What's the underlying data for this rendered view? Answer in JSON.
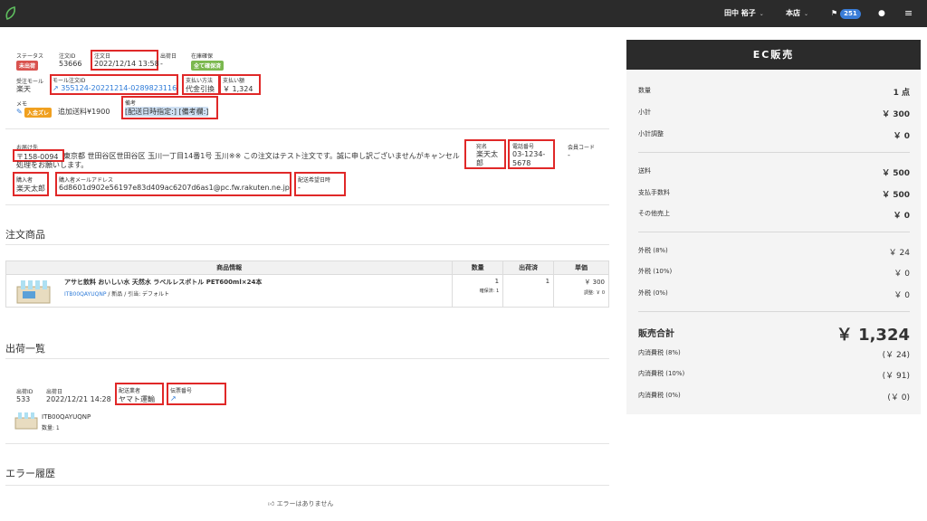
{
  "topbar": {
    "user": "田中 裕子",
    "store": "本店",
    "flag_count": "251",
    "chevron": "⌄"
  },
  "order": {
    "status_label": "ステータス",
    "status_value": "未出荷",
    "order_id_label": "注文ID",
    "order_id": "53666",
    "order_date_label": "注文日",
    "order_date": "2022/12/14 13:58",
    "ship_date_label": "出荷日",
    "ship_date": "-",
    "stock_label": "在庫確保",
    "stock_value": "全て確保済",
    "mall_label": "受注モール",
    "mall": "楽天",
    "mall_order_id_label": "モール注文ID",
    "mall_order_id": "355124-20221214-0289823116",
    "payment_label": "支払い方法",
    "payment": "代金引換",
    "amount_label": "支払い額",
    "amount": "￥ 1,324",
    "memo_label": "メモ",
    "memo_tag": "入金ズレ",
    "memo_text": "追加送料¥1900",
    "remarks_label": "備考",
    "remarks": "[配送日時指定:] [備考欄:]",
    "shipto_label": "お届け先",
    "zip": "〒158-0094",
    "address": "東京都 世田谷区世田谷区 玉川一丁目14番1号 玉川※※ この注文はテスト注文です。誠に申し訳ございませんがキャンセル処理をお願いします。",
    "name_label": "宛名",
    "name": "楽天太郎",
    "phone_label": "電話番号",
    "phone": "03-1234-5678",
    "member_label": "会員コード",
    "member": "-",
    "buyer_label": "購入者",
    "buyer": "楽天太郎",
    "email_label": "購入者メールアドレス",
    "email": "6d8601d902e56197e83d409ac6207d6as1@pc.fw.rakuten.ne.jp",
    "delivery_label": "配送希望日時",
    "delivery": "-"
  },
  "products": {
    "title": "注文商品",
    "headers": [
      "商品情報",
      "数量",
      "出荷済",
      "単価"
    ],
    "item_name": "アサヒ飲料 おいしい水 天然水 ラベルレスボトル PET600ml×24本",
    "item_code": "ITB00QAYUQNP",
    "item_meta": "/ 新品 / 引当: デフォルト",
    "qty": "1",
    "qty_note": "確保済: 1",
    "shipped": "1",
    "price": "￥ 300",
    "price_note": "調整: ￥ 0"
  },
  "shipments": {
    "title": "出荷一覧",
    "ship_id_label": "出荷ID",
    "ship_id": "533",
    "date_label": "出荷日",
    "date": "2022/12/21 14:28",
    "carrier_label": "配送業者",
    "carrier": "ヤマト運輸",
    "tracking_label": "伝票番号",
    "item_code": "ITB00QAYUQNP",
    "item_qty": "数量: 1"
  },
  "errors": {
    "title": "エラー履歴",
    "none": "エラーはありません"
  },
  "sales": {
    "title": "EC販売",
    "rows": [
      {
        "k": "数量",
        "v": "1 点"
      },
      {
        "k": "小計",
        "v": "￥ 300"
      },
      {
        "k": "小計調整",
        "v": "￥ 0"
      },
      {
        "k": "送料",
        "v": "￥ 500"
      },
      {
        "k": "支払手数料",
        "v": "￥ 500"
      },
      {
        "k": "その他売上",
        "v": "￥ 0"
      },
      {
        "k": "外税 (8%)",
        "v": "￥ 24"
      },
      {
        "k": "外税 (10%)",
        "v": "￥ 0"
      },
      {
        "k": "外税 (0%)",
        "v": "￥ 0"
      },
      {
        "k": "販売合計",
        "v": "￥ 1,324"
      },
      {
        "k": "内消費税 (8%)",
        "v": "(￥ 24)"
      },
      {
        "k": "内消費税 (10%)",
        "v": "(￥ 91)"
      },
      {
        "k": "内消費税 (0%)",
        "v": "(￥ 0)"
      }
    ]
  },
  "colors": {
    "red": "#d9534f",
    "green": "#7bb84f",
    "orange": "#f0a020",
    "link": "#2f7bd8",
    "dark": "#2b2b2b"
  }
}
